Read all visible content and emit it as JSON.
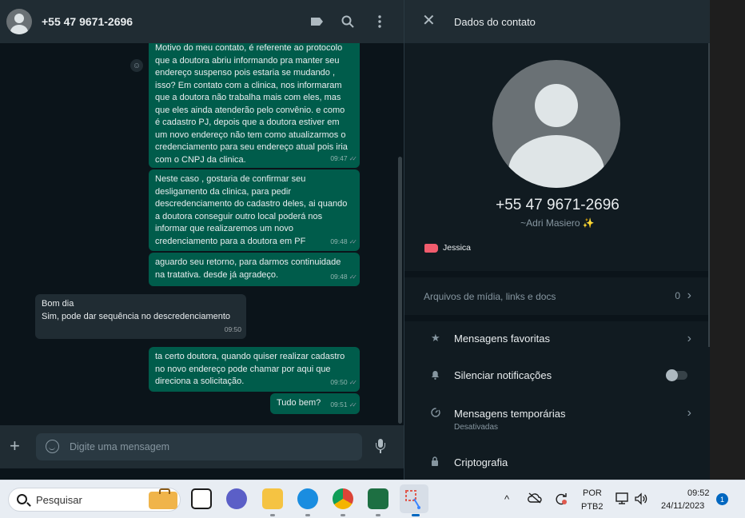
{
  "chat": {
    "contact_name": "+55 47 9671-2696",
    "messages": [
      {
        "direction": "out",
        "text": "Motivo do meu contato, é referente ao protocolo\nque a doutora abriu informando pra manter seu\nendereço suspenso pois estaria se mudando ,\nisso? Em contato com a clinica, nos informaram\nque a doutora não trabalha mais com eles, mas\nque eles ainda atenderão pelo convênio. e como\né cadastro PJ, depois que a doutora estiver em\num novo endereço não tem como atualizarmos o\ncredenciamento para seu endereço atual pois iria\ncom o CNPJ da clinica.",
        "time": "09:47"
      },
      {
        "direction": "out",
        "text": "Neste caso , gostaria de confirmar seu\ndesligamento da clinica, para pedir\ndescredenciamento do cadastro deles, ai quando\na doutora conseguir outro local poderá nos\ninformar que realizaremos um novo\ncredenciamento para a doutora em PF",
        "time": "09:48"
      },
      {
        "direction": "out",
        "text": "aguardo seu retorno, para darmos continuidade\nna tratativa. desde já agradeço.",
        "time": "09:48"
      },
      {
        "direction": "in",
        "text": "Bom dia\nSim, pode dar sequência no descredenciamento",
        "time": "09:50"
      },
      {
        "direction": "out",
        "text": "ta certo doutora, quando quiser realizar cadastro\nno novo endereço pode chamar por aqui que\ndireciona a solicitação.",
        "time": "09:50"
      },
      {
        "direction": "out",
        "text": "Tudo bem?",
        "time": "09:51"
      }
    ],
    "composer_placeholder": "Digite uma mensagem"
  },
  "contact_panel": {
    "title": "Dados do contato",
    "phone": "+55 47 9671-2696",
    "nickname": "~Adri Masiero ✨",
    "label": "Jessica",
    "label_color": "#f15c6d",
    "media_label": "Arquivos de mídia, links e docs",
    "media_count": "0",
    "options": [
      {
        "icon": "star-icon",
        "label": "Mensagens favoritas"
      },
      {
        "icon": "bell-icon",
        "label": "Silenciar notificações"
      },
      {
        "icon": "timer-icon",
        "label": "Mensagens temporárias",
        "sublabel": "Desativadas"
      },
      {
        "icon": "lock-icon",
        "label": "Criptografia"
      }
    ]
  },
  "taskbar": {
    "search_placeholder": "Pesquisar",
    "language": "POR",
    "keyboard": "PTB2",
    "time": "09:52",
    "date": "24/11/2023",
    "notification_count": "1"
  },
  "colors": {
    "outgoing_bubble": "#005c4b",
    "incoming_bubble": "#202c33",
    "app_background": "#0b141a"
  }
}
